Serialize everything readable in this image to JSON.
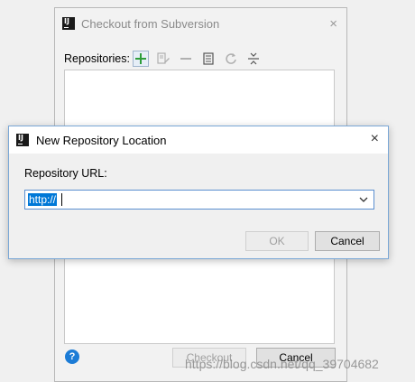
{
  "background_dialog": {
    "title": "Checkout from Subversion",
    "repositories_label": "Repositories:",
    "toolbar_icons": [
      "add-icon",
      "edit-icon",
      "remove-icon",
      "browse-icon",
      "refresh-icon",
      "collapse-icon"
    ],
    "help_glyph": "?",
    "checkout_label": "Checkout",
    "cancel_label": "Cancel",
    "close_glyph": "×"
  },
  "foreground_dialog": {
    "title": "New Repository Location",
    "url_label": "Repository URL:",
    "url_value": "http://",
    "ok_label": "OK",
    "cancel_label": "Cancel",
    "close_glyph": "×"
  },
  "logo_text": "IJ",
  "watermark": "https://blog.csdn.net/qq_39704682",
  "colors": {
    "accent": "#0078d7",
    "add_icon": "#2e9d3a",
    "help": "#1c7cd6",
    "disabled_text": "#a0a0a0"
  }
}
